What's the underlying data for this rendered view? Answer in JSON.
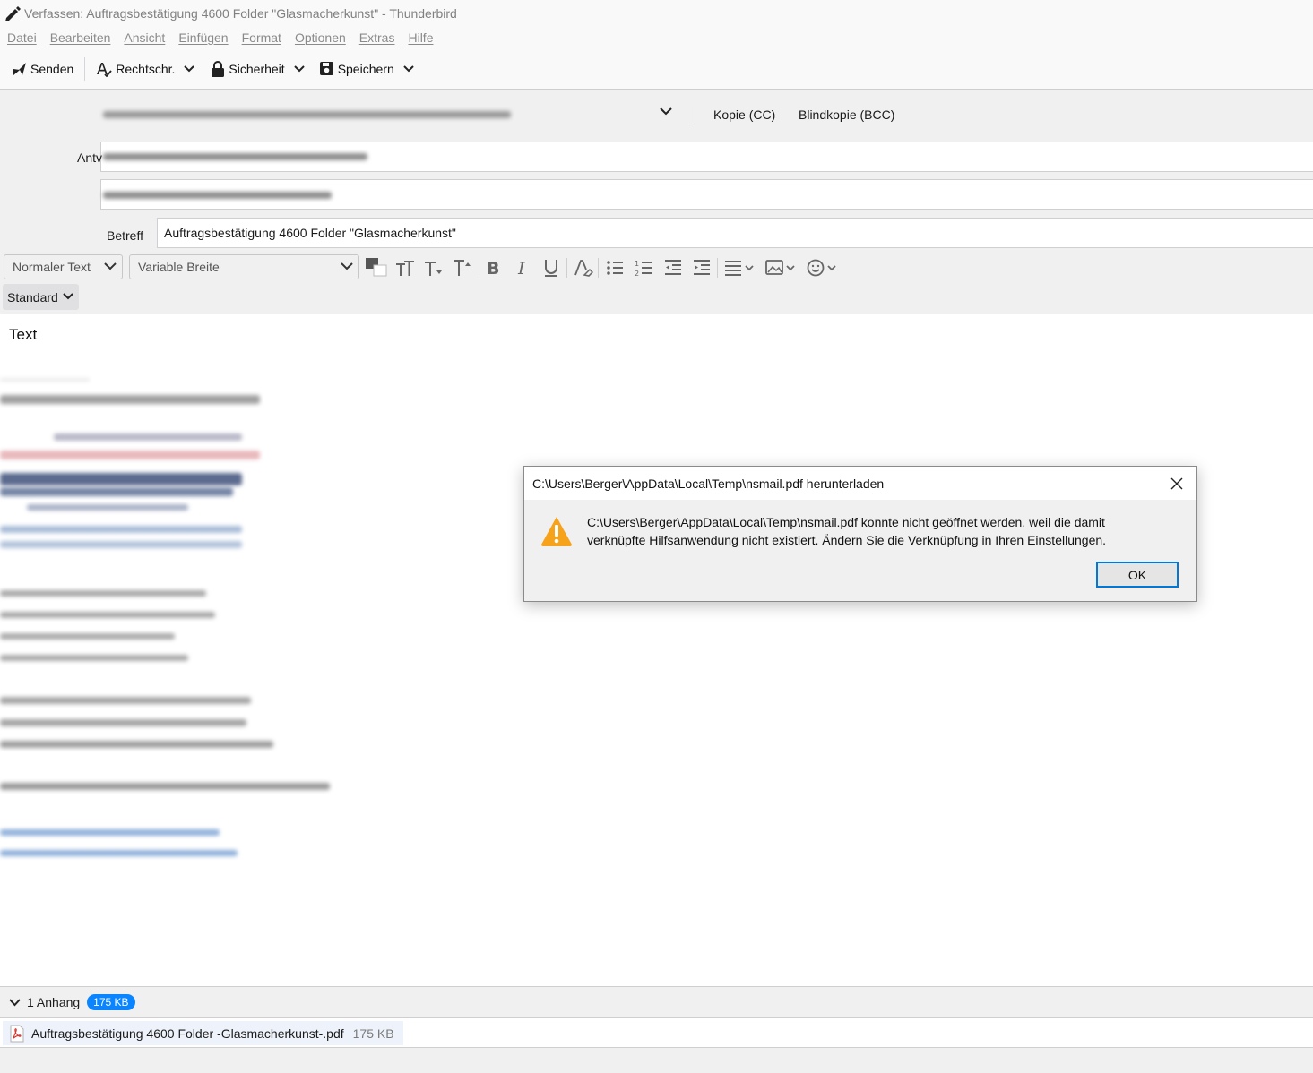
{
  "window": {
    "title": "Verfassen: Auftragsbestätigung 4600 Folder \"Glasmacherkunst\" - Thunderbird"
  },
  "menu": [
    "Datei",
    "Bearbeiten",
    "Ansicht",
    "Einfügen",
    "Format",
    "Optionen",
    "Extras",
    "Hilfe"
  ],
  "toolbar": {
    "send": "Senden",
    "spell": "Rechtschr.",
    "security": "Sicherheit",
    "save": "Speichern"
  },
  "header": {
    "cc": "Kopie (CC)",
    "bcc": "Blindkopie (BCC)",
    "reply_label": "Antv",
    "subject_label": "Betreff",
    "subject_value": "Auftragsbestätigung 4600 Folder \"Glasmacherkunst\""
  },
  "format": {
    "paragraph": "Normaler Text",
    "font": "Variable Breite",
    "style": "Standard"
  },
  "editor": {
    "greeting": "Text"
  },
  "attachments": {
    "summary": "1 Anhang",
    "total_size": "175 KB",
    "items": [
      {
        "name": "Auftragsbestätigung  4600 Folder -Glasmacherkunst-.pdf",
        "size": "175 KB"
      }
    ]
  },
  "dialog": {
    "title": "C:\\Users\\Berger\\AppData\\Local\\Temp\\nsmail.pdf herunterladen",
    "message_line1": "C:\\Users\\Berger\\AppData\\Local\\Temp\\nsmail.pdf konnte nicht geöffnet werden, weil die damit",
    "message_line2": "verknüpfte Hilfsanwendung nicht existiert. Ändern Sie die Verknüpfung in Ihren Einstellungen.",
    "ok": "OK"
  },
  "colors": {
    "accent": "#0a84ff",
    "dialog_focus": "#0078d7",
    "warning": "#f7a21b"
  }
}
